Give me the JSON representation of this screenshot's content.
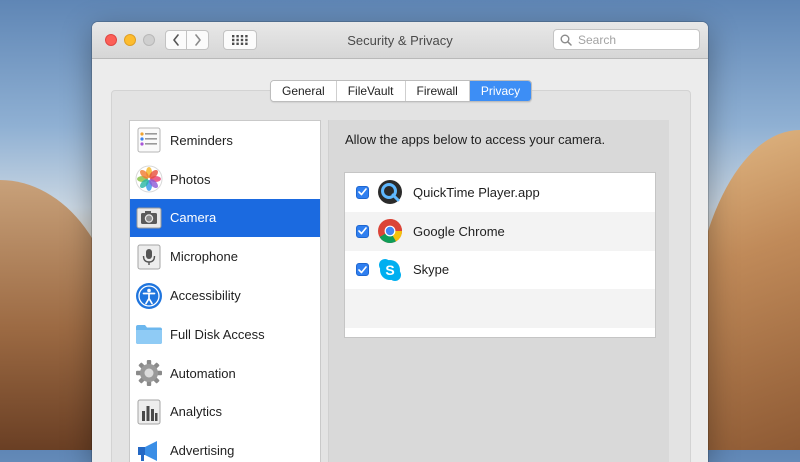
{
  "window": {
    "title": "Security & Privacy"
  },
  "search": {
    "placeholder": "Search"
  },
  "tabs": [
    {
      "label": "General"
    },
    {
      "label": "FileVault"
    },
    {
      "label": "Firewall"
    },
    {
      "label": "Privacy"
    }
  ],
  "sidebar": {
    "items": [
      {
        "label": "Reminders",
        "icon": "reminders-icon"
      },
      {
        "label": "Photos",
        "icon": "photos-icon"
      },
      {
        "label": "Camera",
        "icon": "camera-icon"
      },
      {
        "label": "Microphone",
        "icon": "microphone-icon"
      },
      {
        "label": "Accessibility",
        "icon": "accessibility-icon"
      },
      {
        "label": "Full Disk Access",
        "icon": "folder-icon"
      },
      {
        "label": "Automation",
        "icon": "gear-icon"
      },
      {
        "label": "Analytics",
        "icon": "analytics-icon"
      },
      {
        "label": "Advertising",
        "icon": "megaphone-icon"
      }
    ],
    "selected_index": 2
  },
  "content": {
    "label": "Allow the apps below to access your camera.",
    "apps": [
      {
        "name": "QuickTime Player.app",
        "icon": "quicktime-icon",
        "checked": true
      },
      {
        "name": "Google Chrome",
        "icon": "chrome-icon",
        "checked": true
      },
      {
        "name": "Skype",
        "icon": "skype-icon",
        "checked": true
      }
    ]
  },
  "colors": {
    "accent": "#1b6ae0",
    "tab_active": "#3d8ef5",
    "close": "#fc5f57",
    "minimize": "#fdbc2e"
  }
}
